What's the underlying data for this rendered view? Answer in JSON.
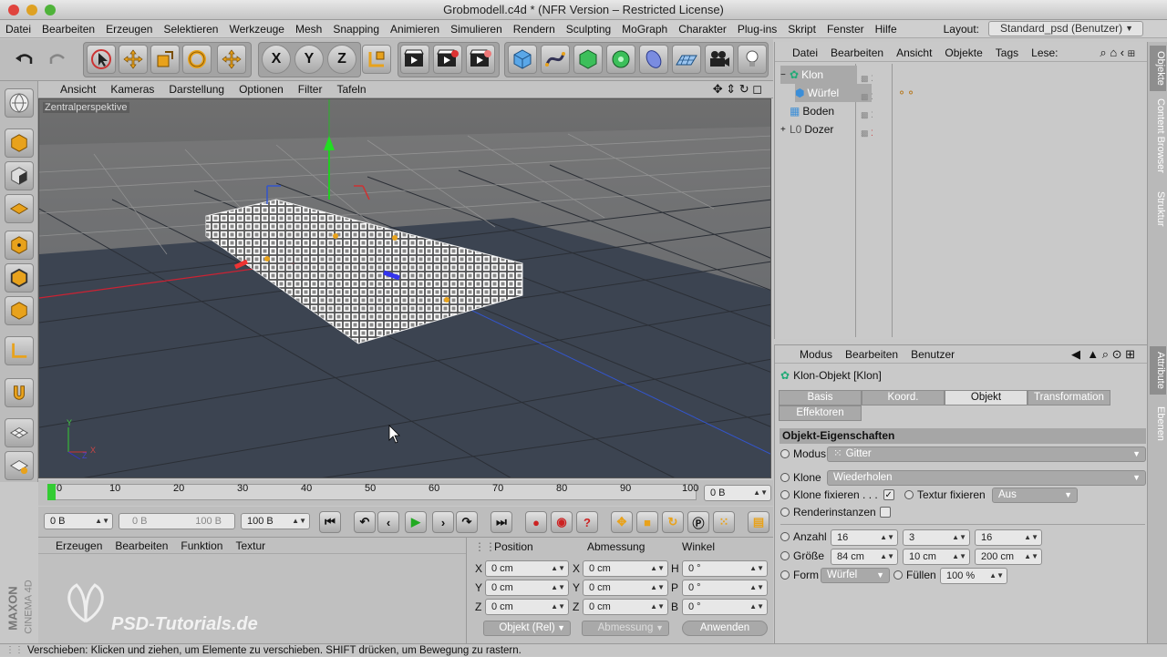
{
  "window": {
    "title": "Grobmodell.c4d * (NFR Version – Restricted License)"
  },
  "menu": [
    "Datei",
    "Bearbeiten",
    "Erzeugen",
    "Selektieren",
    "Werkzeuge",
    "Mesh",
    "Snapping",
    "Animieren",
    "Simulieren",
    "Rendern",
    "Sculpting",
    "MoGraph",
    "Charakter",
    "Plug-ins",
    "Skript",
    "Fenster",
    "Hilfe"
  ],
  "layout": {
    "label": "Layout:",
    "value": "Standard_psd (Benutzer)"
  },
  "toolbar": {
    "x": "X",
    "y": "Y",
    "z": "Z"
  },
  "viewport": {
    "menu": [
      "Ansicht",
      "Kameras",
      "Darstellung",
      "Optionen",
      "Filter",
      "Tafeln"
    ],
    "label": "Zentralperspektive",
    "axis_y": "Y",
    "axis_x": "X",
    "axis_z": "Z"
  },
  "timeline": {
    "ticks": [
      "0",
      "10",
      "20",
      "30",
      "40",
      "50",
      "60",
      "70",
      "80",
      "90",
      "100"
    ],
    "current": "0 B"
  },
  "controls": {
    "start": "0 B",
    "range_start": "0 B",
    "range_end": "100 B",
    "end": "100 B"
  },
  "material": {
    "menu": [
      "Erzeugen",
      "Bearbeiten",
      "Funktion",
      "Textur"
    ]
  },
  "coords": {
    "headers": [
      "Position",
      "Abmessung",
      "Winkel"
    ],
    "rows": [
      {
        "a": "X",
        "pos": "0 cm",
        "b": "X",
        "size": "0 cm",
        "c": "H",
        "ang": "0 °"
      },
      {
        "a": "Y",
        "pos": "0 cm",
        "b": "Y",
        "size": "0 cm",
        "c": "P",
        "ang": "0 °"
      },
      {
        "a": "Z",
        "pos": "0 cm",
        "b": "Z",
        "size": "0 cm",
        "c": "B",
        "ang": "0 °"
      }
    ],
    "mode": "Objekt (Rel)",
    "size_mode": "Abmessung",
    "apply": "Anwenden"
  },
  "brand": {
    "maxon": "MAXON",
    "cinema": "CINEMA 4D",
    "watermark": "PSD-Tutorials.de"
  },
  "status": "Verschieben: Klicken und ziehen, um Elemente zu verschieben. SHIFT drücken, um Bewegung zu rastern.",
  "objects": {
    "menu": [
      "Datei",
      "Bearbeiten",
      "Ansicht",
      "Objekte",
      "Tags",
      "Lese:"
    ],
    "items": [
      {
        "name": "Klon",
        "expand": "−"
      },
      {
        "name": "Würfel",
        "expand": ""
      },
      {
        "name": "Boden",
        "expand": ""
      },
      {
        "name": "Dozer",
        "expand": "+"
      }
    ]
  },
  "attributes": {
    "menu": [
      "Modus",
      "Bearbeiten",
      "Benutzer"
    ],
    "title": "Klon-Objekt [Klon]",
    "tabs": [
      "Basis",
      "Koord.",
      "Objekt",
      "Transformation",
      "Effektoren"
    ],
    "section": "Objekt-Eigenschaften",
    "modus_label": "Modus",
    "modus_value": "Gitter",
    "klone_label": "Klone",
    "klone_value": "Wiederholen",
    "fix_label": "Klone fixieren . . .",
    "fix_check": "✓",
    "texfix_label": "Textur fixieren",
    "texfix_value": "Aus",
    "render_label": "Renderinstanzen",
    "anzahl_label": "Anzahl",
    "anzahl": [
      "16",
      "3",
      "16"
    ],
    "groesse_label": "Größe",
    "groesse": [
      "84 cm",
      "10 cm",
      "200 cm"
    ],
    "form_label": "Form",
    "form_value": "Würfel",
    "fuellen_label": "Füllen",
    "fuellen_value": "100 %"
  },
  "sidetabs": [
    "Objekte",
    "Content Browser",
    "Struktur",
    "Attribute",
    "Ebenen"
  ]
}
